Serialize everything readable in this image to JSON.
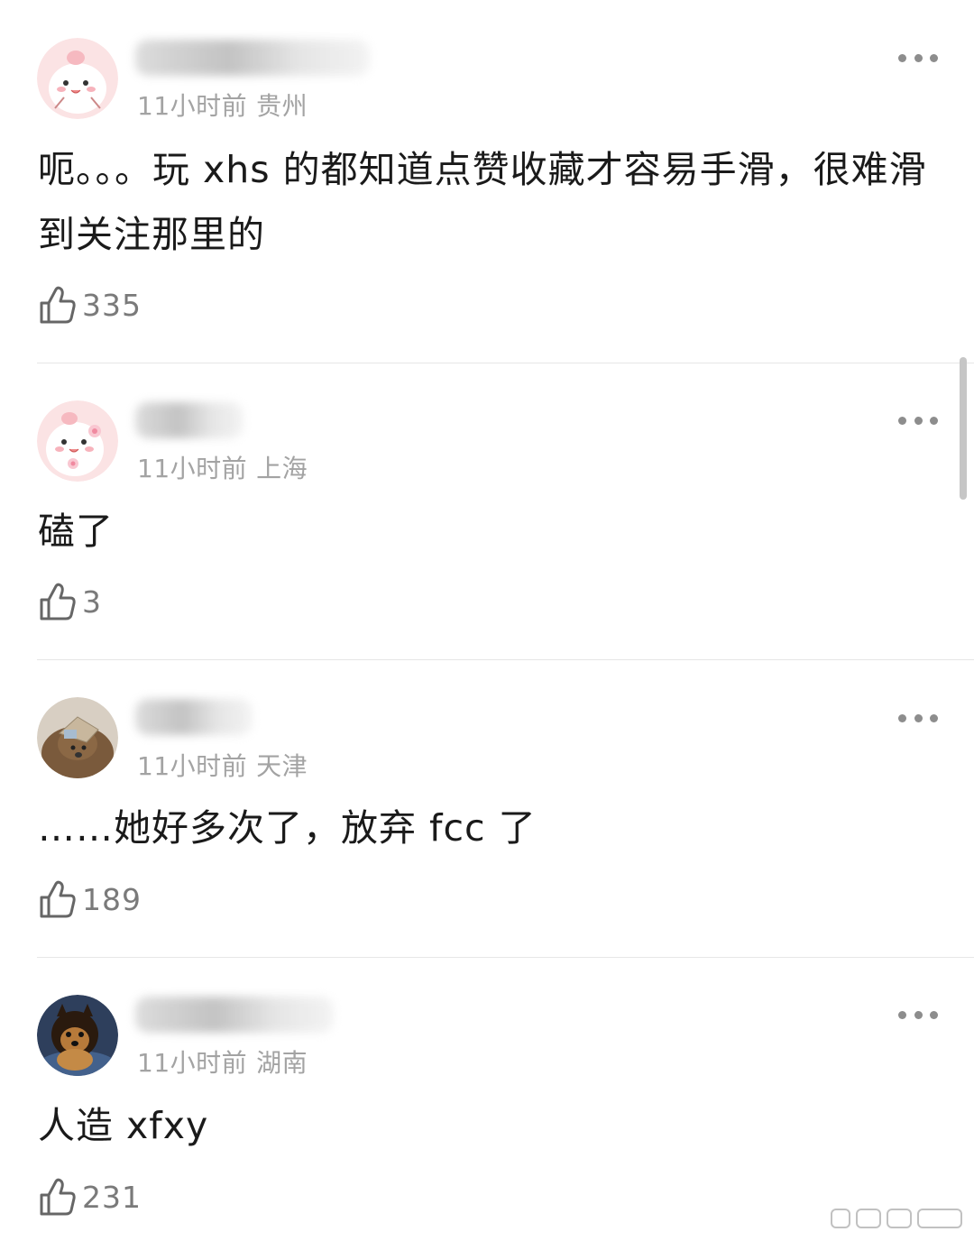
{
  "comments": [
    {
      "time": "11小时前",
      "location": "贵州",
      "text": "呃。。。玩 xhs 的都知道点赞收藏才容易手滑，很难滑到关注那里的",
      "likes": "335",
      "avatar": "pink-mochi-avatar"
    },
    {
      "time": "11小时前",
      "location": "上海",
      "text": "磕了",
      "likes": "3",
      "avatar": "pink-mochi-flower-avatar"
    },
    {
      "time": "11小时前",
      "location": "天津",
      "text": "……她好多次了，放弃 fcc 了",
      "likes": "189",
      "avatar": "dog-photo-avatar"
    },
    {
      "time": "11小时前",
      "location": "湖南",
      "text": "人造 xfxy",
      "likes": "231",
      "avatar": "pomeranian-photo-avatar"
    }
  ],
  "icons": {
    "like": "thumbs-up-icon",
    "more": "more-dots-icon"
  },
  "colors": {
    "meta_gray": "#a3a3a3",
    "text": "#1a1a1a",
    "like_gray": "#7a7a7a"
  }
}
